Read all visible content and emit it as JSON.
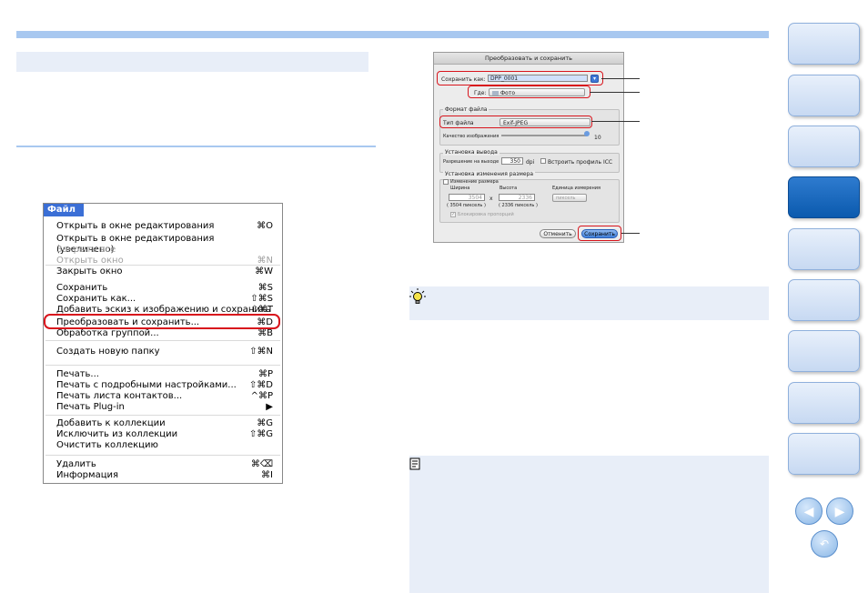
{
  "menu": {
    "header": "Файл",
    "items": [
      {
        "label": "Открыть в окне редактирования",
        "shortcut": "⌘O",
        "disabled": false
      },
      {
        "label": "Открыть в окне редактирования (увеличено)",
        "shortcut": "",
        "disabled": false
      },
      {
        "label": "Закрыть все",
        "shortcut": "",
        "disabled": true
      },
      {
        "label": "Открыть окно",
        "shortcut": "⌘N",
        "disabled": true
      },
      {
        "label": "Закрыть окно",
        "shortcut": "⌘W",
        "disabled": false
      },
      {
        "label": "Сохранить",
        "shortcut": "⌘S",
        "disabled": false
      },
      {
        "label": "Сохранить как...",
        "shortcut": "⇧⌘S",
        "disabled": false
      },
      {
        "label": "Добавить эскиз к изображению и сохранить",
        "shortcut": "⇧⌘T",
        "disabled": false
      },
      {
        "label": "Преобразовать и сохранить...",
        "shortcut": "⌘D",
        "disabled": false
      },
      {
        "label": "Обработка группой...",
        "shortcut": "⌘B",
        "disabled": false
      },
      {
        "label": "Создать новую папку",
        "shortcut": "⇧⌘N",
        "disabled": false
      },
      {
        "label": "Печать...",
        "shortcut": "⌘P",
        "disabled": false
      },
      {
        "label": "Печать с подробными настройками...",
        "shortcut": "⇧⌘D",
        "disabled": false
      },
      {
        "label": "Печать листа контактов...",
        "shortcut": "^⌘P",
        "disabled": false
      },
      {
        "label": "Печать Plug-in",
        "shortcut": "▶",
        "disabled": false
      },
      {
        "label": "Добавить к коллекции",
        "shortcut": "⌘G",
        "disabled": false
      },
      {
        "label": "Исключить из коллекции",
        "shortcut": "⇧⌘G",
        "disabled": false
      },
      {
        "label": "Очистить коллекцию",
        "shortcut": "",
        "disabled": false
      },
      {
        "label": "Удалить",
        "shortcut": "⌘⌫",
        "disabled": false
      },
      {
        "label": "Информация",
        "shortcut": "⌘I",
        "disabled": false
      }
    ]
  },
  "dialog": {
    "title": "Преобразовать и сохранить",
    "save_as_label": "Сохранить как:",
    "save_as_value": "DPP_0001",
    "where_label": "Где:",
    "where_value": "Фото",
    "file_format_group": "Формат файла",
    "file_type_label": "Тип файла",
    "file_type_value": "Exif-JPEG",
    "quality_label": "Качество изображения",
    "quality_value": "10",
    "output_group": "Установка вывода",
    "resolution_label": "Разрешение на выходе",
    "resolution_value": "350",
    "resolution_unit": "dpi",
    "embed_icc_label": "Встроить профиль ICC",
    "resize_group": "Установка изменения размера",
    "resize_checkbox_label": "Изменение размера",
    "width_label": "Ширина",
    "height_label": "Высота",
    "unit_label": "Единица измерения",
    "width_value": "3504",
    "height_value": "2336",
    "times_sign": "x",
    "width_px": "( 3504 пиксель )",
    "height_px": "( 2336 пиксель )",
    "unit_value": "пиксель",
    "lock_aspect_label": "Блокировка пропорций",
    "cancel_label": "Отменить",
    "save_label": "Сохранить"
  },
  "icons": {
    "tip": "lightbulb-icon",
    "note": "note-icon",
    "prev": "arrow-left-icon",
    "next": "arrow-right-icon",
    "back": "return-icon"
  }
}
